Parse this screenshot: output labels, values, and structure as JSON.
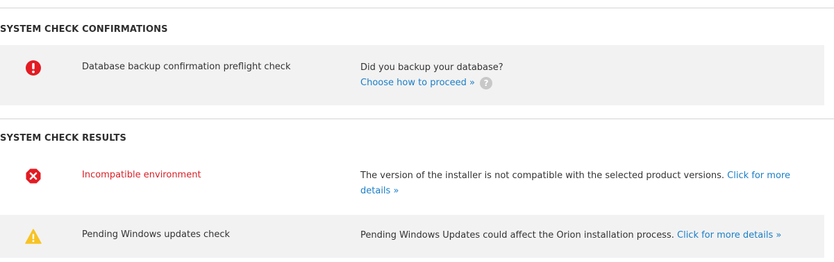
{
  "confirmations": {
    "title": "SYSTEM CHECK CONFIRMATIONS",
    "items": [
      {
        "icon": "exclamation-circle-icon",
        "icon_color": "#e31b23",
        "name": "Database backup confirmation preflight check",
        "question": "Did you backup your database?",
        "link": "Choose how to proceed »",
        "help": "?"
      }
    ]
  },
  "results": {
    "title": "SYSTEM CHECK RESULTS",
    "items": [
      {
        "icon": "error-octagon-icon",
        "icon_color": "#e31b23",
        "name": "Incompatible environment",
        "name_color": "#d81f26",
        "desc": "The version of the installer is not compatible with the selected product versions. ",
        "link": "Click for more details »"
      },
      {
        "icon": "warning-triangle-icon",
        "icon_color": "#f7c324",
        "name": "Pending Windows updates check",
        "desc": "Pending Windows Updates could affect the Orion installation process. ",
        "link": "Click for more details »"
      }
    ]
  }
}
